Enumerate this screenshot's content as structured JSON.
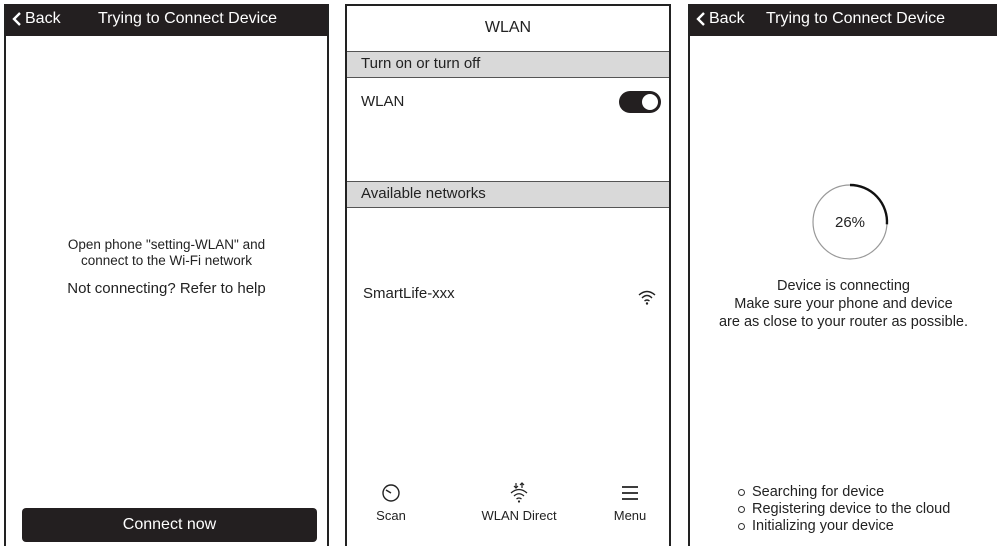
{
  "left_screen": {
    "back_label": "Back",
    "title": "Trying to Connect Device",
    "instruction_line1": "Open phone \"setting-WLAN\" and",
    "instruction_line2": "connect to the Wi-Fi network",
    "help_text": "Not connecting? Refer to help",
    "connect_button": "Connect now"
  },
  "middle_screen": {
    "title": "WLAN",
    "section_toggle": "Turn on or turn off",
    "wlan_label": "WLAN",
    "wlan_enabled": true,
    "section_networks": "Available networks",
    "networks": [
      {
        "name": "SmartLife-xxx",
        "icon": "wifi-icon"
      }
    ],
    "bottom_bar": {
      "scan": "Scan",
      "wlan_direct": "WLAN Direct",
      "menu": "Menu"
    }
  },
  "right_screen": {
    "back_label": "Back",
    "title": "Trying to Connect Device",
    "progress_percent": 26,
    "progress_label": "26%",
    "status_line1": "Device is connecting",
    "status_line2": "Make sure your phone and device",
    "status_line3": "are as close to your router as possible.",
    "steps": [
      "Searching for device",
      "Registering device to the cloud",
      "Initializing your device"
    ]
  },
  "colors": {
    "dark": "#231f20",
    "section_bg": "#d9d9d9"
  }
}
